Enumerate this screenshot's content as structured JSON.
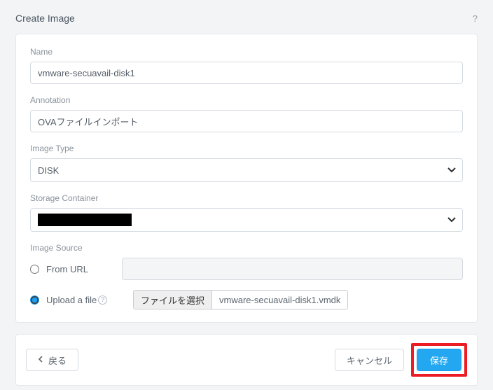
{
  "header": {
    "title": "Create Image"
  },
  "fields": {
    "name": {
      "label": "Name",
      "value": "vmware-secuavail-disk1"
    },
    "annotation": {
      "label": "Annotation",
      "value": "OVAファイルインポート"
    },
    "image_type": {
      "label": "Image Type",
      "selected": "DISK"
    },
    "storage_container": {
      "label": "Storage Container"
    },
    "image_source": {
      "label": "Image Source",
      "from_url": {
        "label": "From URL",
        "selected": false
      },
      "upload_file": {
        "label": "Upload a file",
        "selected": true,
        "choose_button": "ファイルを選択",
        "file_name": "vmware-secuavail-disk1.vmdk"
      }
    }
  },
  "footer": {
    "back": "戻る",
    "cancel": "キャンセル",
    "save": "保存"
  }
}
